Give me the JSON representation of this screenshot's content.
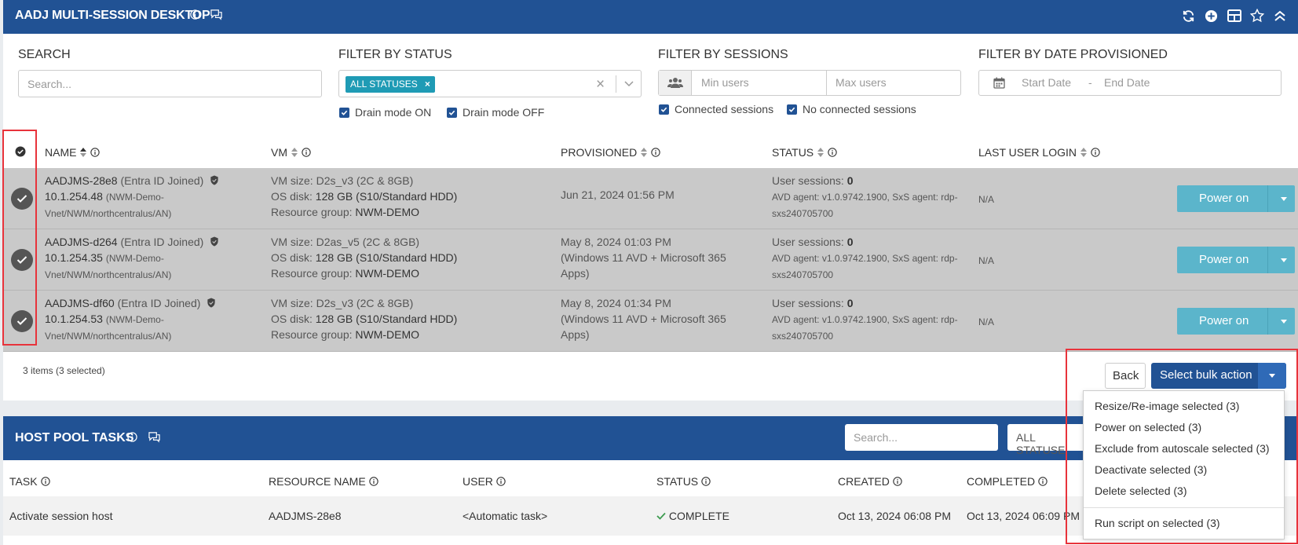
{
  "header": {
    "title": "AADJ MULTI-SESSION DESKTOP",
    "icons": [
      "info-icon",
      "chat-icon",
      "refresh-icon",
      "add-icon",
      "grid-icon",
      "star-icon",
      "collapse-icon"
    ]
  },
  "filters": {
    "search_label": "SEARCH",
    "search_placeholder": "Search...",
    "status_label": "FILTER BY STATUS",
    "status_chip": "ALL STATUSES",
    "drain_on": "Drain mode ON",
    "drain_off": "Drain mode OFF",
    "sessions_label": "FILTER BY SESSIONS",
    "min_users": "Min users",
    "max_users": "Max users",
    "connected": "Connected sessions",
    "no_connected": "No connected sessions",
    "date_label": "FILTER BY DATE PROVISIONED",
    "start_date": "Start Date",
    "date_sep": "-",
    "end_date": "End Date"
  },
  "table": {
    "columns": [
      "NAME",
      "VM",
      "PROVISIONED",
      "STATUS",
      "LAST USER LOGIN"
    ],
    "rows": [
      {
        "name": "AADJMS-28e8",
        "join": "(Entra ID Joined)",
        "ip": "10.1.254.48",
        "net1": "(NWM-Demo-",
        "net2": "Vnet/NWM/northcentralus/AN)",
        "vm_size_label": "VM size:",
        "vm_size": "D2s_v3 (2C & 8GB)",
        "os_label": "OS disk:",
        "os": "128 GB (S10/Standard HDD)",
        "rg_label": "Resource group:",
        "rg": "NWM-DEMO",
        "prov1": "Jun 21, 2024 01:56 PM",
        "prov2": "",
        "prov3": "",
        "sessions_label": "User sessions:",
        "sessions": "0",
        "agent1": "AVD agent: v1.0.9742.1900, SxS agent: rdp-",
        "agent2": "sxs240705700",
        "last_login": "N/A",
        "action": "Power on"
      },
      {
        "name": "AADJMS-d264",
        "join": "(Entra ID Joined)",
        "ip": "10.1.254.35",
        "net1": "(NWM-Demo-",
        "net2": "Vnet/NWM/northcentralus/AN)",
        "vm_size_label": "VM size:",
        "vm_size": "D2as_v5 (2C & 8GB)",
        "os_label": "OS disk:",
        "os": "128 GB (S10/Standard HDD)",
        "rg_label": "Resource group:",
        "rg": "NWM-DEMO",
        "prov1": "May 8, 2024 01:03 PM",
        "prov2": "(Windows 11 AVD + Microsoft 365",
        "prov3": "Apps)",
        "sessions_label": "User sessions:",
        "sessions": "0",
        "agent1": "AVD agent: v1.0.9742.1900, SxS agent: rdp-",
        "agent2": "sxs240705700",
        "last_login": "N/A",
        "action": "Power on"
      },
      {
        "name": "AADJMS-df60",
        "join": "(Entra ID Joined)",
        "ip": "10.1.254.53",
        "net1": "(NWM-Demo-",
        "net2": "Vnet/NWM/northcentralus/AN)",
        "vm_size_label": "VM size:",
        "vm_size": "D2s_v3 (2C & 8GB)",
        "os_label": "OS disk:",
        "os": "128 GB (S10/Standard HDD)",
        "rg_label": "Resource group:",
        "rg": "NWM-DEMO",
        "prov1": "May 8, 2024 01:34 PM",
        "prov2": "(Windows 11 AVD + Microsoft 365",
        "prov3": "Apps)",
        "sessions_label": "User sessions:",
        "sessions": "0",
        "agent1": "AVD agent: v1.0.9742.1900, SxS agent: rdp-",
        "agent2": "sxs240705700",
        "last_login": "N/A",
        "action": "Power on"
      }
    ],
    "count": "3 items (3 selected)"
  },
  "bulk": {
    "back": "Back",
    "select": "Select bulk action",
    "menu": [
      "Resize/Re-image selected (3)",
      "Power on selected (3)",
      "Exclude from autoscale selected (3)",
      "Deactivate selected (3)",
      "Delete selected (3)",
      "Run script on selected (3)"
    ]
  },
  "tasks": {
    "title": "HOST POOL TASKS",
    "search_placeholder": "Search...",
    "status_filter": "ALL STATUSE",
    "columns": [
      "TASK",
      "RESOURCE NAME",
      "USER",
      "STATUS",
      "CREATED",
      "COMPLETED"
    ],
    "row": {
      "task": "Activate session host",
      "resource": "AADJMS-28e8",
      "user": "<Automatic task>",
      "status": "COMPLETE",
      "created": "Oct 13, 2024 06:08 PM",
      "completed": "Oct 13, 2024 06:09 PM"
    }
  },
  "colors": {
    "header_blue": "#215294",
    "teal_button": "#5bb5cb",
    "chip": "#1f9bb5",
    "highlight_red": "#e8333b",
    "selected_row": "#c9c9c9"
  }
}
